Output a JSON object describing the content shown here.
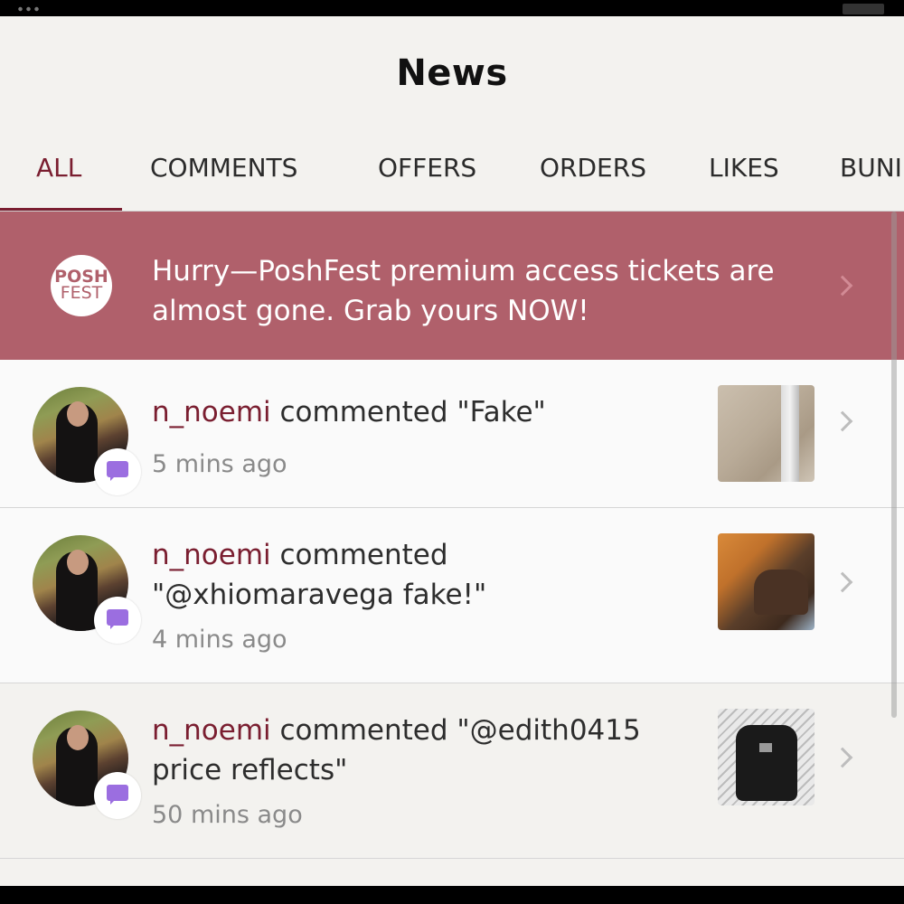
{
  "header": {
    "title": "News"
  },
  "tabs": [
    {
      "label": "ALL",
      "active": true
    },
    {
      "label": "COMMENTS",
      "active": false
    },
    {
      "label": "OFFERS",
      "active": false
    },
    {
      "label": "ORDERS",
      "active": false
    },
    {
      "label": "LIKES",
      "active": false
    },
    {
      "label": "BUNI",
      "active": false
    }
  ],
  "promo": {
    "logo_line1": "POSH",
    "logo_line2": "FEST",
    "text": "Hurry—PoshFest premium access tickets are almost gone. Grab yours NOW!"
  },
  "notifications": [
    {
      "user": "n_noemi",
      "action": " commented \"Fake\"",
      "time": "5 mins ago",
      "thumb_icon": "handbag-lining-photo"
    },
    {
      "user": "n_noemi",
      "action": " commented \"@xhiomaravega fake!\"",
      "time": "4 mins ago",
      "thumb_icon": "louis-vuitton-bag-photo"
    },
    {
      "user": "n_noemi",
      "action": " commented \"@edith0415 price reflects\"",
      "time": "50 mins ago",
      "thumb_icon": "black-backpack-photo"
    }
  ],
  "colors": {
    "accent": "#7a1e30",
    "promo_bg": "#b0606b",
    "badge": "#9b6ee0"
  }
}
